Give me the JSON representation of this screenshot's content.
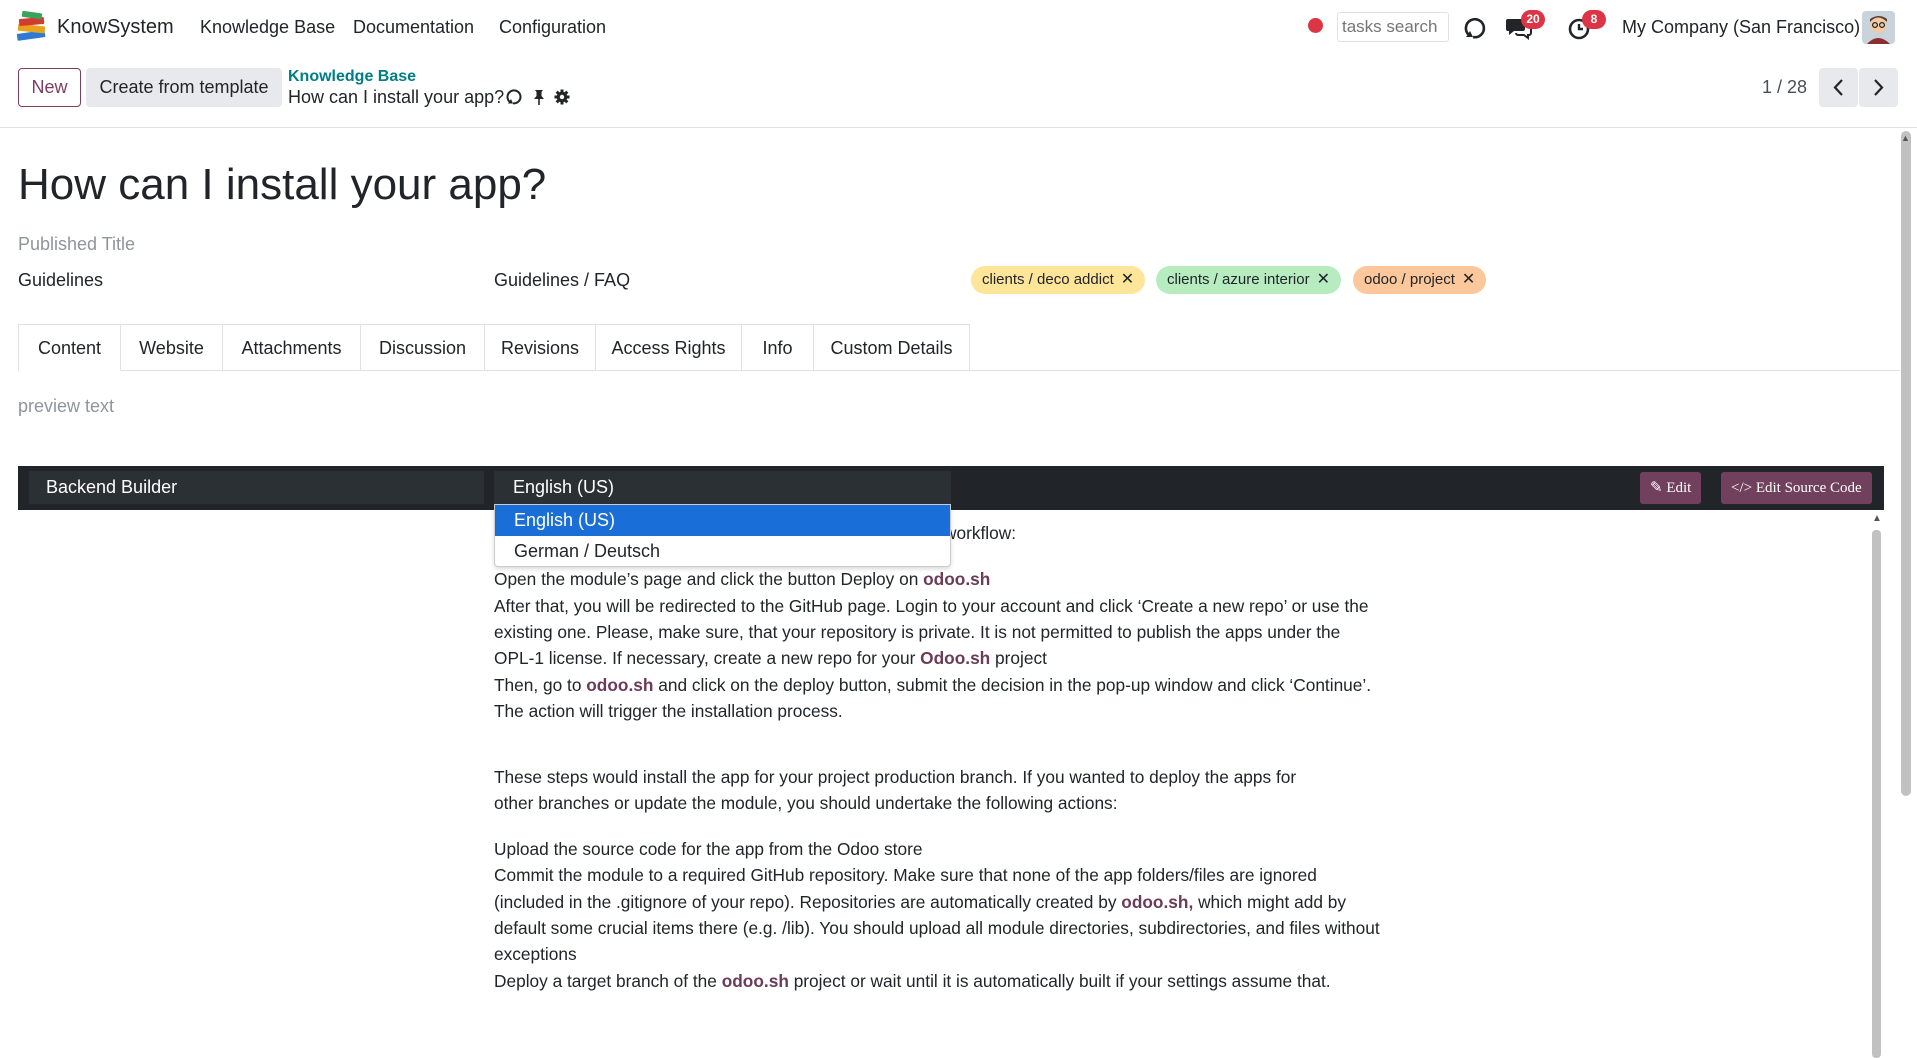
{
  "navbar": {
    "brand": "KnowSystem",
    "menu": [
      "Knowledge Base",
      "Documentation",
      "Configuration"
    ],
    "search_placeholder": "tasks search",
    "messages_count": "20",
    "activities_count": "8",
    "company": "My Company (San Francisco)"
  },
  "control_panel": {
    "new_label": "New",
    "template_label": "Create from template",
    "breadcrumb_parent": "Knowledge Base",
    "breadcrumb_current": "How can I install your app?",
    "pager": "1 / 28"
  },
  "form": {
    "title": "How can I install your app?",
    "published_title_placeholder": "Published Title",
    "section": "Guidelines",
    "category": "Guidelines / FAQ",
    "tags": [
      {
        "label": "clients / deco addict",
        "color": "#fde59a"
      },
      {
        "label": "clients / azure interior",
        "color": "#b7ecc1"
      },
      {
        "label": "odoo / project",
        "color": "#fcc79a"
      }
    ],
    "tabs": [
      "Content",
      "Website",
      "Attachments",
      "Discussion",
      "Revisions",
      "Access Rights",
      "Info",
      "Custom Details"
    ],
    "preview_placeholder": "preview text"
  },
  "editor": {
    "builder": "Backend Builder",
    "language": "English (US)",
    "language_options": [
      "English (US)",
      "German / Deutsch"
    ],
    "edit_label": "Edit",
    "edit_source_label": "Edit Source Code"
  },
  "content": {
    "heading_visible": "workflow:",
    "p1_pre": "Open the module’s page and click the button Deploy on ",
    "p1_link": "odoo.sh",
    "p2_line1": "After that, you will be redirected to the GitHub page. Login to your account and click ‘Create a new repo’ or use the",
    "p2_line2": "existing one. Please, make sure, that your repository is private. It is not permitted to publish the apps under the",
    "p2_line3_pre": "OPL-1 license. If necessary, create a new repo for your ",
    "p2_line3_link": "Odoo.sh",
    "p2_line3_post": " project",
    "p3_pre": "Then, go to ",
    "p3_link": "odoo.sh",
    "p3_post": " and click on the deploy button, submit the decision in the pop-up window and click ‘Continue’.",
    "p4": "The action will trigger the installation process.",
    "bold_line1": "These steps would install the app for your project production branch. If you wanted to deploy the apps for",
    "bold_line2": "other branches or update the module, you should undertake the following actions:",
    "s1": "Upload the source code for the app from the Odoo store",
    "s2_line1": "Commit the module to a required GitHub repository. Make sure that none of the app folders/files are ignored",
    "s2_line2_pre": "(included in the .gitignore of your repo). Repositories are automatically created by ",
    "s2_line2_link": "odoo.sh,",
    "s2_line2_post": " which might add by",
    "s2_line3": "default some crucial items there (e.g. /lib). You should upload all module directories, subdirectories, and files without",
    "s2_line4": "exceptions",
    "s3_pre": "Deploy a target branch of the ",
    "s3_link": "odoo.sh",
    "s3_post": " project or wait until it is automatically built if your settings assume that."
  }
}
